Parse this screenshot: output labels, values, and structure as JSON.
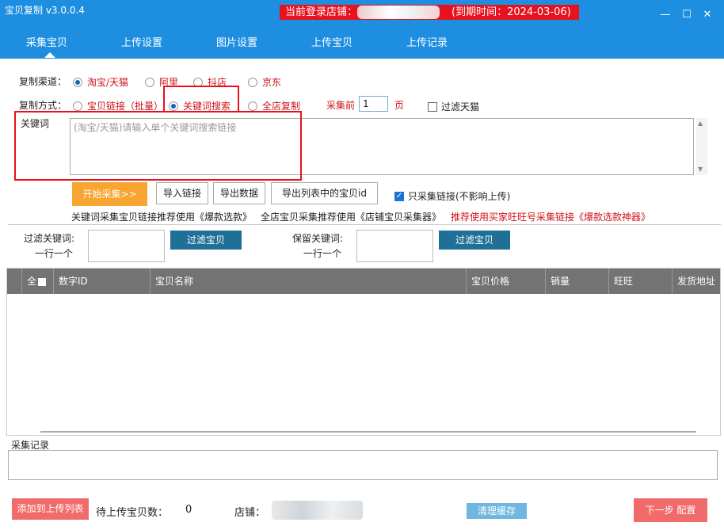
{
  "app": {
    "title": "宝贝复制 v3.0.0.4",
    "login_label": "当前登录店铺：",
    "expire_label": "(到期时间：2024-03-06)",
    "window_buttons": [
      "minimize-icon",
      "maximize-icon",
      "close-icon"
    ],
    "window_button_glyphs": [
      "—",
      "☐",
      "✕"
    ]
  },
  "tabs": [
    "采集宝贝",
    "上传设置",
    "图片设置",
    "上传宝贝",
    "上传记录"
  ],
  "channel": {
    "label": "复制渠道：",
    "options": [
      "淘宝/天猫",
      "阿里",
      "抖店",
      "京东"
    ],
    "selected": "淘宝/天猫"
  },
  "mode": {
    "label": "复制方式：",
    "options": [
      "宝贝链接（批量）",
      "关键词搜索",
      "全店复制"
    ],
    "selected": "关键词搜索",
    "pages_prefix": "采集前",
    "pages_value": "1",
    "pages_suffix": "页",
    "filter_tmall_label": "过滤天猫",
    "filter_tmall_checked": false
  },
  "keyword": {
    "label": "关键词",
    "placeholder": "(淘宝/天猫)请输入单个关键词搜索链接"
  },
  "actions": {
    "start": "开始采集>>",
    "import": "导入链接",
    "export": "导出数据",
    "export_ids": "导出列表中的宝贝id",
    "only_links_label": "只采集链接(不影响上传)",
    "only_links_checked": true
  },
  "hints": [
    "关键词采集宝贝链接推荐使用《爆款选款》",
    "全店宝贝采集推荐使用《店铺宝贝采集器》",
    "推荐使用买家旺旺号采集链接《爆款选款神器》"
  ],
  "filters": {
    "filter_kw_label1": "过滤关键词:",
    "filter_kw_label2": "一行一个",
    "filter_button": "过滤宝贝",
    "keep_kw_label1": "保留关键词:",
    "keep_kw_label2": "一行一个",
    "keep_button": "过滤宝贝"
  },
  "table": {
    "columns": [
      "全",
      "数字ID",
      "宝贝名称",
      "宝贝价格",
      "销量",
      "旺旺",
      "发货地址"
    ],
    "rows": []
  },
  "log": {
    "label": "采集记录"
  },
  "footer": {
    "add_to_upload": "添加到上传列表",
    "pending_label": "待上传宝贝数：",
    "pending_count": "0",
    "shop_label": "店铺：",
    "clear_cache": "清理缓存",
    "next_step": "下一步  配置"
  },
  "colors": {
    "brand_blue": "#1e8fe0",
    "accent_red": "#e8121e",
    "orange": "#f8a531",
    "teal": "#1f6f96"
  }
}
